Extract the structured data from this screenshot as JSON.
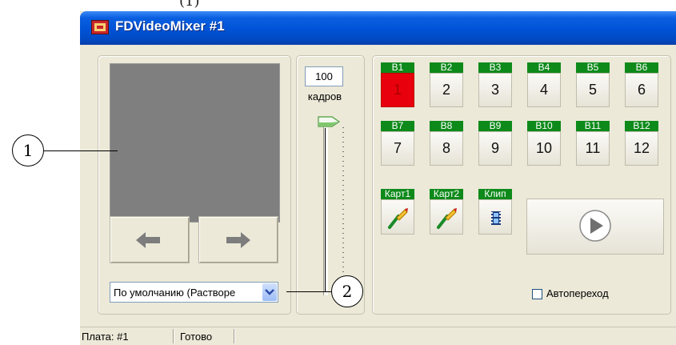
{
  "top_fragment": "(1)",
  "window": {
    "title": "FDVideoMixer #1"
  },
  "transition": {
    "frames_value": "100",
    "frames_label": "кадров",
    "combo_value": "По умолчанию (Растворе"
  },
  "buses": [
    {
      "label": "B1",
      "number": "1",
      "active": true
    },
    {
      "label": "B2",
      "number": "2",
      "active": false
    },
    {
      "label": "B3",
      "number": "3",
      "active": false
    },
    {
      "label": "B4",
      "number": "4",
      "active": false
    },
    {
      "label": "B5",
      "number": "5",
      "active": false
    },
    {
      "label": "B6",
      "number": "6",
      "active": false
    },
    {
      "label": "B7",
      "number": "7",
      "active": false
    },
    {
      "label": "B8",
      "number": "8",
      "active": false
    },
    {
      "label": "B9",
      "number": "9",
      "active": false
    },
    {
      "label": "B10",
      "number": "10",
      "active": false
    },
    {
      "label": "B11",
      "number": "11",
      "active": false
    },
    {
      "label": "B12",
      "number": "12",
      "active": false
    }
  ],
  "media": [
    {
      "label": "Карт1",
      "icon": "brush-icon"
    },
    {
      "label": "Карт2",
      "icon": "brush-icon"
    },
    {
      "label": "Клип",
      "icon": "film-icon"
    }
  ],
  "autotransition": {
    "label": "Автопереход",
    "checked": false
  },
  "status": {
    "board": "Плата: #1",
    "state": "Готово"
  },
  "callouts": {
    "c1": "1",
    "c2": "2"
  },
  "colors": {
    "active_bus": "#e8000c",
    "bus_header": "#0e8a1b",
    "titlebar": "#0053d6"
  }
}
